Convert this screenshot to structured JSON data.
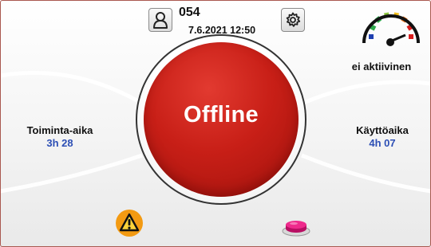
{
  "header": {
    "device_id": "054",
    "datetime": "7.6.2021 12:50",
    "user_icon": "user-icon",
    "settings_icon": "gear-icon"
  },
  "gauge": {
    "status": "ei aktiivinen",
    "icon": "speed-gauge-icon",
    "colors": [
      "#1e3fb0",
      "#2ca84a",
      "#8cc63f",
      "#f2c01e",
      "#e8731c",
      "#d91e1e"
    ]
  },
  "main_button": {
    "label": "Offline",
    "color": "#c81f17"
  },
  "left_stat": {
    "label": "Toiminta-aika",
    "value": "3h 28"
  },
  "right_stat": {
    "label": "Käyttöaika",
    "value": "4h 07"
  },
  "bottom": {
    "warning_icon": "warning-icon",
    "button_icon": "push-button-icon"
  },
  "colors": {
    "value_text": "#2d4fb5",
    "warning": "#f39a12",
    "push_button": "#e0127a"
  }
}
